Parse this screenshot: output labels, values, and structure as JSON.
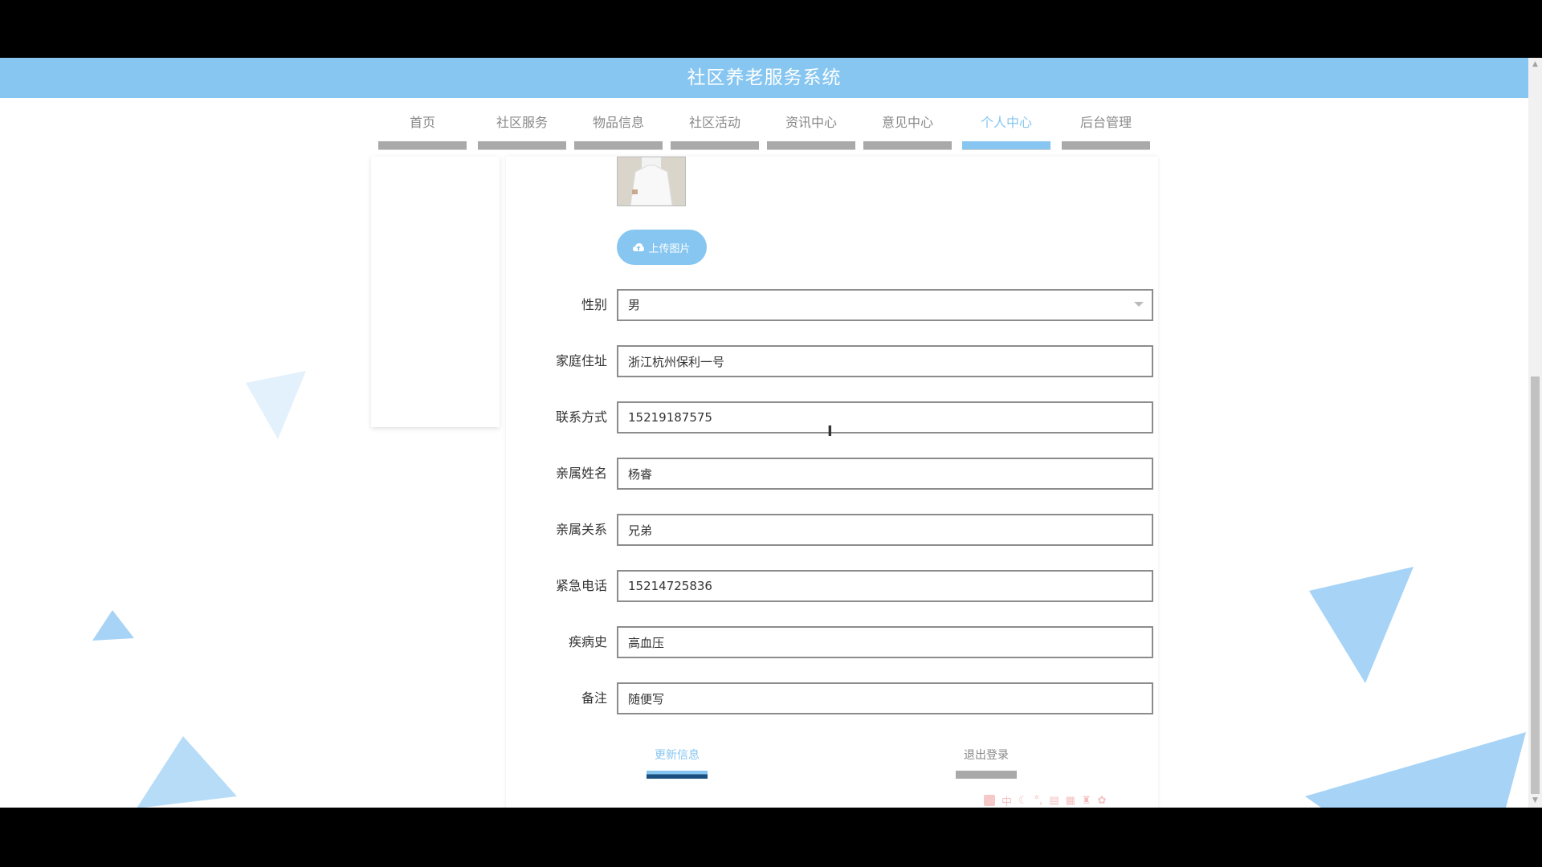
{
  "app": {
    "title": "社区养老服务系统"
  },
  "nav": {
    "items": [
      {
        "label": "首页"
      },
      {
        "label": "社区服务"
      },
      {
        "label": "物品信息"
      },
      {
        "label": "社区活动"
      },
      {
        "label": "资讯中心"
      },
      {
        "label": "意见中心"
      },
      {
        "label": "个人中心",
        "active": true
      },
      {
        "label": "后台管理"
      }
    ]
  },
  "profile": {
    "upload_label": "上传图片",
    "fields": [
      {
        "label": "性别",
        "value": "男",
        "type": "select"
      },
      {
        "label": "家庭住址",
        "value": "浙江杭州保利一号"
      },
      {
        "label": "联系方式",
        "value": "15219187575"
      },
      {
        "label": "亲属姓名",
        "value": "杨睿"
      },
      {
        "label": "亲属关系",
        "value": "兄弟"
      },
      {
        "label": "紧急电话",
        "value": "15214725836"
      },
      {
        "label": "疾病史",
        "value": "高血压"
      },
      {
        "label": "备注",
        "value": "随便写"
      }
    ]
  },
  "actions": {
    "update_label": "更新信息",
    "logout_label": "退出登录"
  },
  "ime": {
    "char": "中"
  },
  "colors": {
    "accent": "#86c6f0",
    "inactive_bar": "#a9a9a9",
    "decor": "#a6d3f6"
  },
  "icons": {
    "upload": "cloud-upload-icon",
    "select": "chevron-down-icon"
  }
}
